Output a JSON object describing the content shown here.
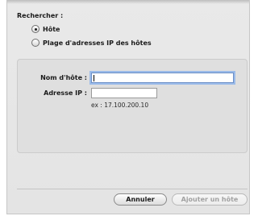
{
  "search": {
    "label": "Rechercher :",
    "options": [
      {
        "label": "Hôte",
        "selected": true
      },
      {
        "label": "Plage d'adresses IP des hôtes",
        "selected": false
      }
    ]
  },
  "form": {
    "hostname_label": "Nom d'hôte :",
    "hostname_value": "",
    "ip_label": "Adresse IP :",
    "ip_value": "",
    "ip_hint": "ex : 17.100.200.10"
  },
  "buttons": {
    "cancel_label": "Annuler",
    "add_label": "Ajouter un hôte",
    "add_enabled": false
  }
}
